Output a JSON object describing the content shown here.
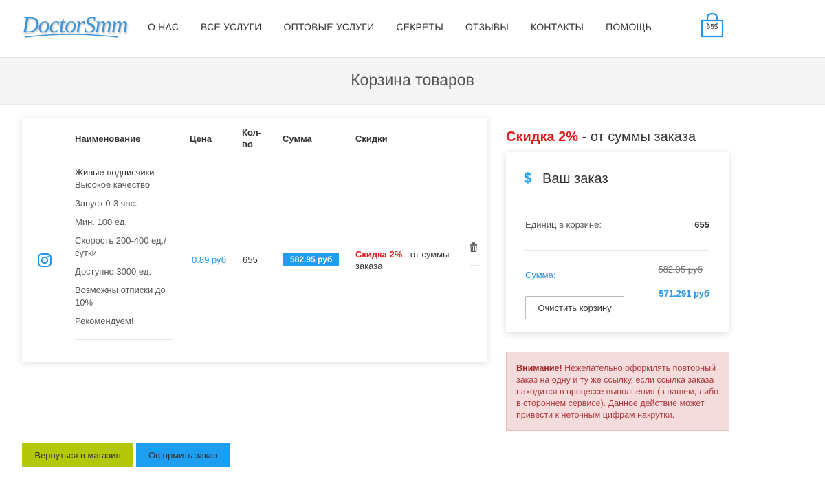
{
  "header": {
    "logo_text": "DoctorSmm",
    "nav": [
      "О НАС",
      "ВСЕ УСЛУГИ",
      "ОПТОВЫЕ УСЛУГИ",
      "СЕКРЕТЫ",
      "ОТЗЫВЫ",
      "КОНТАКТЫ",
      "ПОМОЩЬ"
    ],
    "cart_count": "655",
    "cart_icon": "shopping-bag-icon"
  },
  "page_title": "Корзина товаров",
  "table": {
    "headers": {
      "name": "Наименование",
      "price": "Цена",
      "qty": "Кол-во",
      "sum": "Сумма",
      "discount": "Скидки"
    },
    "row": {
      "icon": "instagram-icon",
      "product_name": "Живые подписчики",
      "features": [
        "Высокое качество",
        "Запуск 0-3 час.",
        "Мин. 100 ед.",
        "Скорость 200-400 ед./ сутки",
        "Доступно 3000 ед.",
        "Возможны отписки до 10%",
        "Рекомендуем!"
      ],
      "price": "0.89 руб",
      "qty": "655",
      "sum": "582.95 руб",
      "discount_red": "Скидка 2%",
      "discount_rest": " - от суммы заказа",
      "delete_icon": "trash-icon"
    }
  },
  "discount_heading": {
    "red": "Скидка 2%",
    "rest": " - от суммы заказа"
  },
  "order": {
    "title": "Ваш заказ",
    "units_label": "Единиц в корзине:",
    "units_value": "655",
    "sum_label": "Сумма:",
    "old_price": "582.95 руб",
    "new_price": "571.291 руб",
    "clear_button": "Очистить корзину"
  },
  "warning": {
    "bold": "Внимание!",
    "text": " Нежелательно оформлять повторный заказ на одну и ту же ссылку, если ссылка заказа находится в процессе выполнения (в нашем, либо в стороннем сервисе). Данное действие может привести к неточным цифрам накрутки."
  },
  "buttons": {
    "back": "Вернуться в магазин",
    "checkout": "Оформить заказ"
  },
  "colors": {
    "accent_blue": "#1e9ef0",
    "discount_red": "#e21b1b",
    "back_button": "#b4c80a",
    "warning_bg": "#f4dcdd"
  }
}
